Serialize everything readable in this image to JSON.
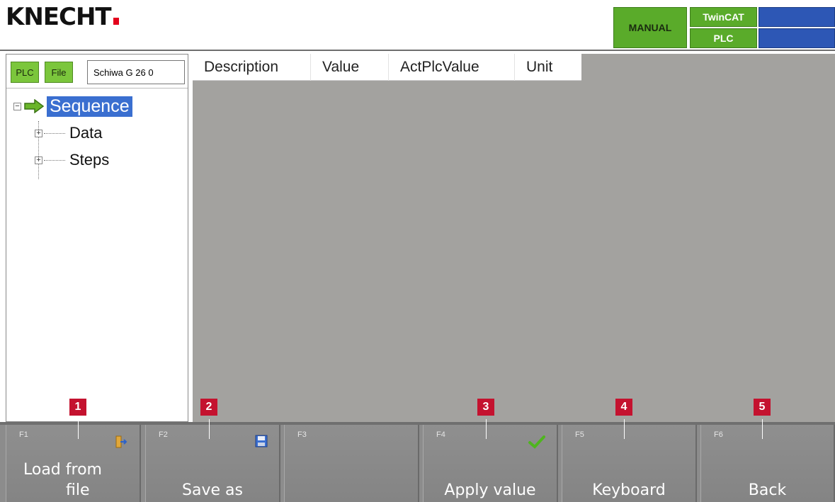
{
  "header": {
    "logo_text": "KNECHT",
    "mode": "MANUAL",
    "twincat_label": "TwinCAT",
    "plc_label": "PLC",
    "colors": {
      "mode_green": "#5aab2a",
      "status_blue": "#2d57b5",
      "logo_red": "#e3001b"
    }
  },
  "left_panel": {
    "plc_button": "PLC",
    "file_button": "File",
    "project_name": "Schiwa G 26 0",
    "tree": {
      "root": "Sequence",
      "children": [
        "Data",
        "Steps"
      ]
    }
  },
  "table": {
    "columns": [
      "Description",
      "Value",
      "ActPlcValue",
      "Unit"
    ]
  },
  "function_keys": [
    {
      "key": "F1",
      "label_line1": "Load from",
      "label_line2": "file",
      "icon": "load-file-icon"
    },
    {
      "key": "F2",
      "label": "Save as",
      "icon": "floppy-disk-icon"
    },
    {
      "key": "F3",
      "label": ""
    },
    {
      "key": "F4",
      "label": "Apply value",
      "icon": "checkmark-icon"
    },
    {
      "key": "F5",
      "label": "Keyboard"
    },
    {
      "key": "F6",
      "label": "Back"
    }
  ],
  "callouts": [
    "1",
    "2",
    "3",
    "4",
    "5"
  ]
}
